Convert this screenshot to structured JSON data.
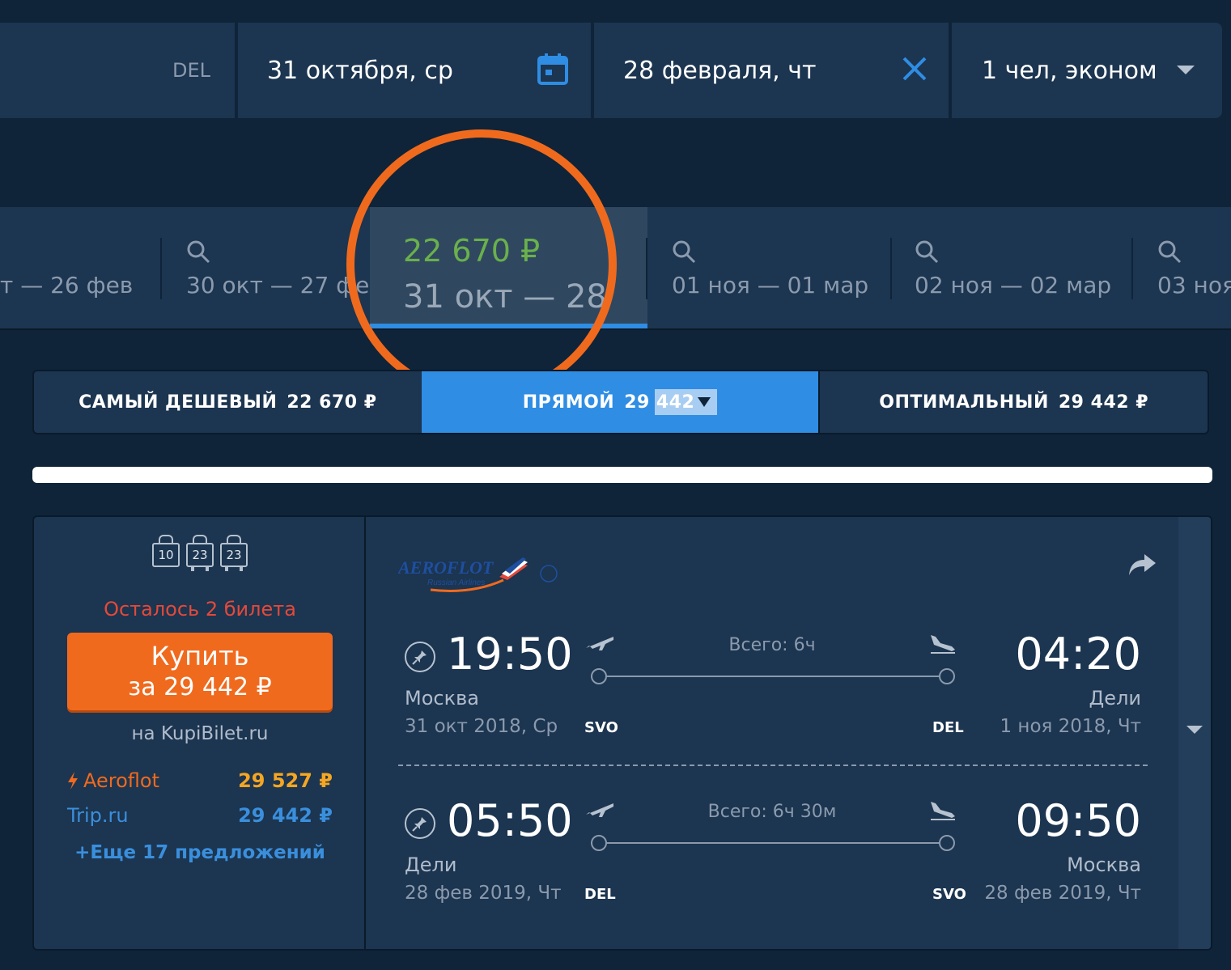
{
  "search": {
    "origin": "DEL",
    "depart_date": "31 октября, ср",
    "return_date": "28 февраля, чт",
    "passengers": "1 чел, эконом"
  },
  "dates": [
    {
      "label": "т — 26 фев"
    },
    {
      "label": "30 окт — 27 фе"
    },
    {
      "label": "01 ноя — 01 мар"
    },
    {
      "label": "02 ноя — 02 мар"
    },
    {
      "label": "03 ноя"
    }
  ],
  "active_date": {
    "price": "22 670 ₽",
    "label": "31 окт — 28"
  },
  "tabs": [
    {
      "label": "САМЫЙ ДЕШЕВЫЙ",
      "value": "22 670 ₽"
    },
    {
      "label": "ПРЯМОЙ",
      "value_a": "29",
      "value_b": "442"
    },
    {
      "label": "ОПТИМАЛЬНЫЙ",
      "value": "29 442 ₽"
    }
  ],
  "progress": 1.0,
  "card": {
    "baggage": [
      "10",
      "23",
      "23"
    ],
    "remaining": "Осталось 2 билета",
    "buy_line1": "Купить",
    "buy_line2": "за 29 442 ₽",
    "seller": "на KupiBilet.ru",
    "offers": [
      {
        "name": "Aeroflot",
        "price": "29 527 ₽"
      },
      {
        "name": "Trip.ru",
        "price": "29 442 ₽"
      }
    ],
    "more": "+Еще 17 предложений",
    "airline": "AEROFLOT",
    "airline_sub": "Russian Airlines",
    "segments": [
      {
        "dep_time": "19:50",
        "dep_city": "Москва",
        "dep_date": "31 окт 2018, Ср",
        "dep_code": "SVO",
        "arr_time": "04:20",
        "arr_city": "Дели",
        "arr_date": "1 ноя 2018, Чт",
        "arr_code": "DEL",
        "duration": "Всего: 6ч"
      },
      {
        "dep_time": "05:50",
        "dep_city": "Дели",
        "dep_date": "28 фев 2019, Чт",
        "dep_code": "DEL",
        "arr_time": "09:50",
        "arr_city": "Москва",
        "arr_date": "28 фев 2019, Чт",
        "arr_code": "SVO",
        "duration": "Всего: 6ч 30м"
      }
    ]
  },
  "colors": {
    "background": "#0f2439",
    "panel": "#1c3550",
    "accent_blue": "#2f8de4",
    "accent_orange": "#f06a1e",
    "price_green": "#6ab04c",
    "alert_red": "#e5493a"
  }
}
